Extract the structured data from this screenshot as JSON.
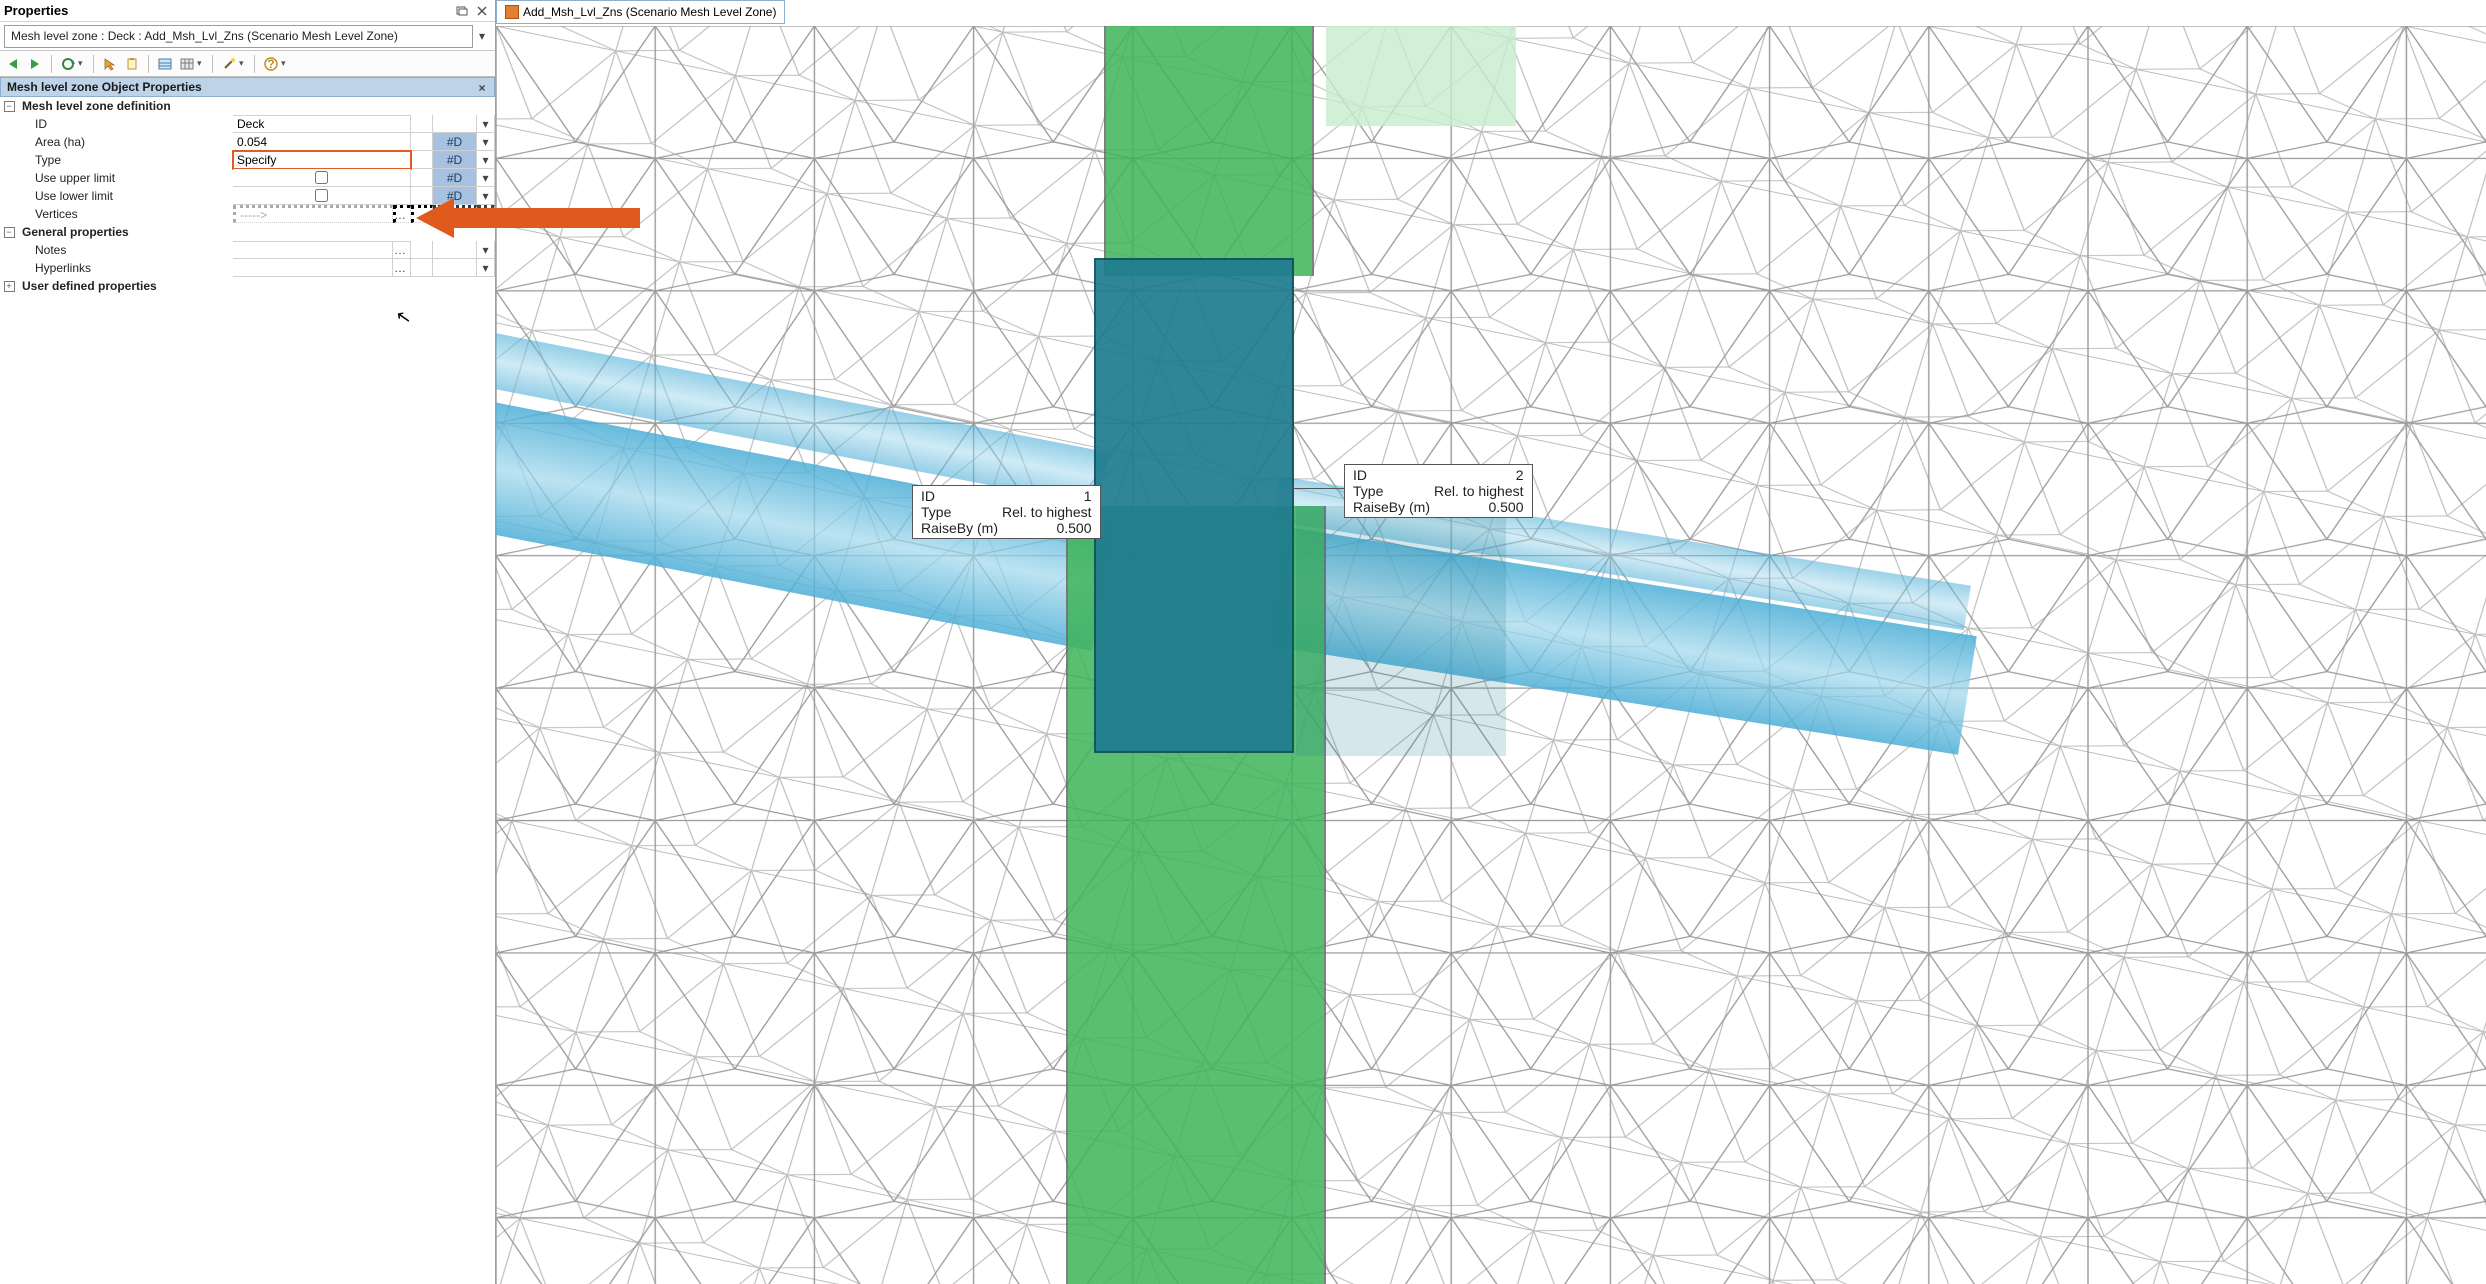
{
  "panel": {
    "title": "Properties",
    "breadcrumb": "Mesh level zone : Deck : Add_Msh_Lvl_Zns (Scenario Mesh Level Zone)",
    "section_header": "Mesh level zone Object Properties",
    "groups": {
      "definition": "Mesh level zone definition",
      "general": "General properties",
      "user": "User defined properties"
    },
    "rows": {
      "id_label": "ID",
      "id_value": "Deck",
      "area_label": "Area (ha)",
      "area_value": "0.054",
      "type_label": "Type",
      "type_value": "Specify",
      "upper_label": "Use upper limit",
      "lower_label": "Use lower limit",
      "vertices_label": "Vertices",
      "vertices_value": "----->",
      "notes_label": "Notes",
      "hyperlinks_label": "Hyperlinks"
    },
    "tag": "#D"
  },
  "viewport": {
    "tab_title": "Add_Msh_Lvl_Zns (Scenario Mesh Level Zone)"
  },
  "tooltip1": {
    "id_k": "ID",
    "id_v": "1",
    "type_k": "Type",
    "type_v": "Rel. to highest",
    "raise_k": "RaiseBy (m)",
    "raise_v": "0.500"
  },
  "tooltip2": {
    "id_k": "ID",
    "id_v": "2",
    "type_k": "Type",
    "type_v": "Rel. to highest",
    "raise_k": "RaiseBy (m)",
    "raise_v": "0.500"
  }
}
